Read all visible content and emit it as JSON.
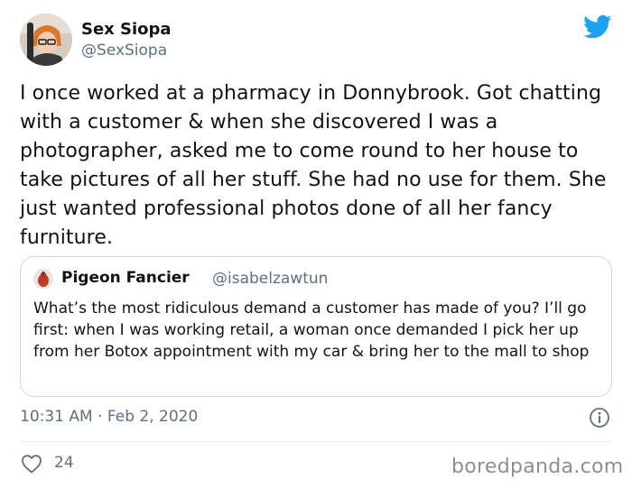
{
  "author": {
    "name": "Sex Siopa",
    "handle": "@SexSiopa"
  },
  "tweet": {
    "text": "I once worked at a pharmacy in Donnybrook. Got chatting with a customer & when she discovered I was a photographer, asked me to come round to her house to take pictures of all her stuff. She had no use for them. She just wanted professional photos done of all her fancy furniture."
  },
  "quote": {
    "name": "Pigeon Fancier",
    "handle": "@isabelzawtun",
    "text": "What’s the most ridiculous demand a customer has made of you? I’ll go first: when I was working retail, a woman once demanded I pick her up from her Botox appointment with my car & bring her to the mall to shop"
  },
  "meta": {
    "timestamp": "10:31 AM · Feb 2, 2020",
    "like_count": "24"
  },
  "watermark": "boredpanda.com",
  "colors": {
    "twitter_blue": "#1da1f2",
    "secondary_text": "#5b7083",
    "border": "#cfd9de"
  },
  "icons": {
    "brand": "twitter-bird-icon",
    "info": "info-icon",
    "like": "heart-outline-icon"
  }
}
